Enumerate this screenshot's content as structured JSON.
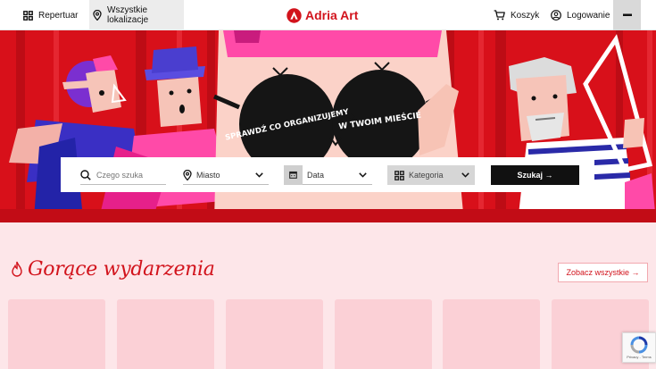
{
  "header": {
    "repertoire_label": "Repertuar",
    "locations_label": "Wszystkie lokalizacje",
    "logo_text": "Adria Art",
    "cart_label": "Koszyk",
    "login_label": "Logowanie"
  },
  "hero": {
    "lens_left_text": "SPRAWDŹ CO ORGANIZUJEMY",
    "lens_right_text": "W TWOIM MIEŚCIE"
  },
  "search": {
    "what_placeholder": "Czego szuka",
    "city_label": "Miasto",
    "date_label": "Data",
    "category_label": "Kategoria",
    "submit_label": "Szukaj →"
  },
  "hot_events": {
    "title": "Gorące wydarzenia",
    "see_all_label": "Zobacz wszystkie →",
    "cards": [
      {},
      {},
      {},
      {},
      {},
      {}
    ]
  },
  "recaptcha": {
    "text": "Privacy - Terms"
  },
  "colors": {
    "brand_red": "#d2131c",
    "page_bg": "#fde6e9",
    "card_bg": "#fbd0d6",
    "button_dark": "#111111"
  }
}
